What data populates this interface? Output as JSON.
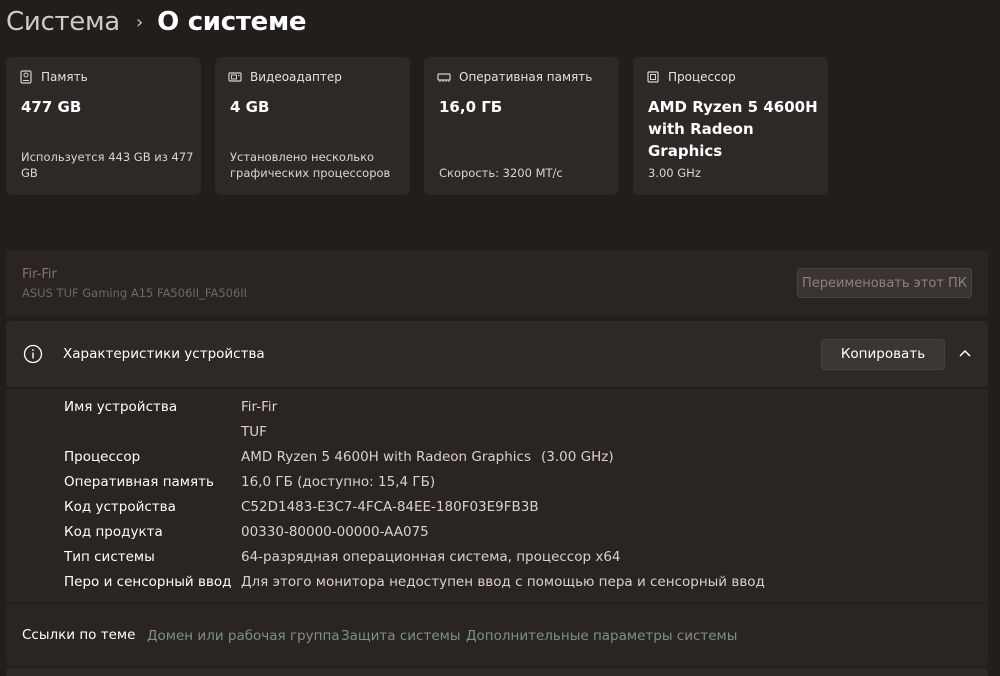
{
  "breadcrumb": {
    "parent": "Система",
    "separator": "›",
    "current": "О системе"
  },
  "cards": [
    {
      "icon": "storage-icon",
      "label": "Память",
      "value": "477 GB",
      "sub_line1": "Используется 443 GB из 477",
      "sub_line2": "GB"
    },
    {
      "icon": "display-adapter-icon",
      "label": "Видеоадаптер",
      "value": "4 GB",
      "sub_line1": "Установлено несколько",
      "sub_line2": "графических процессоров"
    },
    {
      "icon": "ram-icon",
      "label": "Оперативная память",
      "value": "16,0 ГБ",
      "sub_line1": "Скорость: 3200 МТ/с"
    },
    {
      "icon": "processor-icon",
      "label": "Процессор",
      "value_line1": "AMD Ryzen 5 4600H",
      "value_line2": "with Radeon Graphics",
      "sub_line1": "3.00 GHz"
    }
  ],
  "pc": {
    "name": "Fir-Fir",
    "model": "ASUS TUF Gaming A15 FA506II_FA506II",
    "rename_label": "Переименовать этот ПК"
  },
  "specs": {
    "title": "Характеристики устройства",
    "copy_label": "Копировать",
    "rows": [
      {
        "key": "Имя устройства",
        "value": "Fir-Fir"
      },
      {
        "key": "",
        "value": "TUF"
      },
      {
        "key": "Процессор",
        "value": "AMD Ryzen 5 4600H with Radeon Graphics",
        "extra": "(3.00 GHz)"
      },
      {
        "key": "Оперативная память",
        "value": "16,0 ГБ (доступно: 15,4 ГБ)"
      },
      {
        "key": "Код устройства",
        "value": "C52D1483-E3C7-4FCA-84EE-180F03E9FB3B"
      },
      {
        "key": "Код продукта",
        "value": "00330-80000-00000-AA075"
      },
      {
        "key": "Тип системы",
        "value": "64-разрядная операционная система, процессор x64"
      },
      {
        "key": "Перо и сенсорный ввод",
        "value": "Для этого монитора недоступен ввод с помощью пера и сенсорный ввод"
      }
    ]
  },
  "related": {
    "title": "Ссылки по теме",
    "links": [
      "Домен или рабочая группа",
      "Защита системы",
      "Дополнительные параметры системы"
    ]
  },
  "colors": {
    "background": "#231d1b",
    "card": "#2e2826",
    "link": "#7f8f89"
  }
}
